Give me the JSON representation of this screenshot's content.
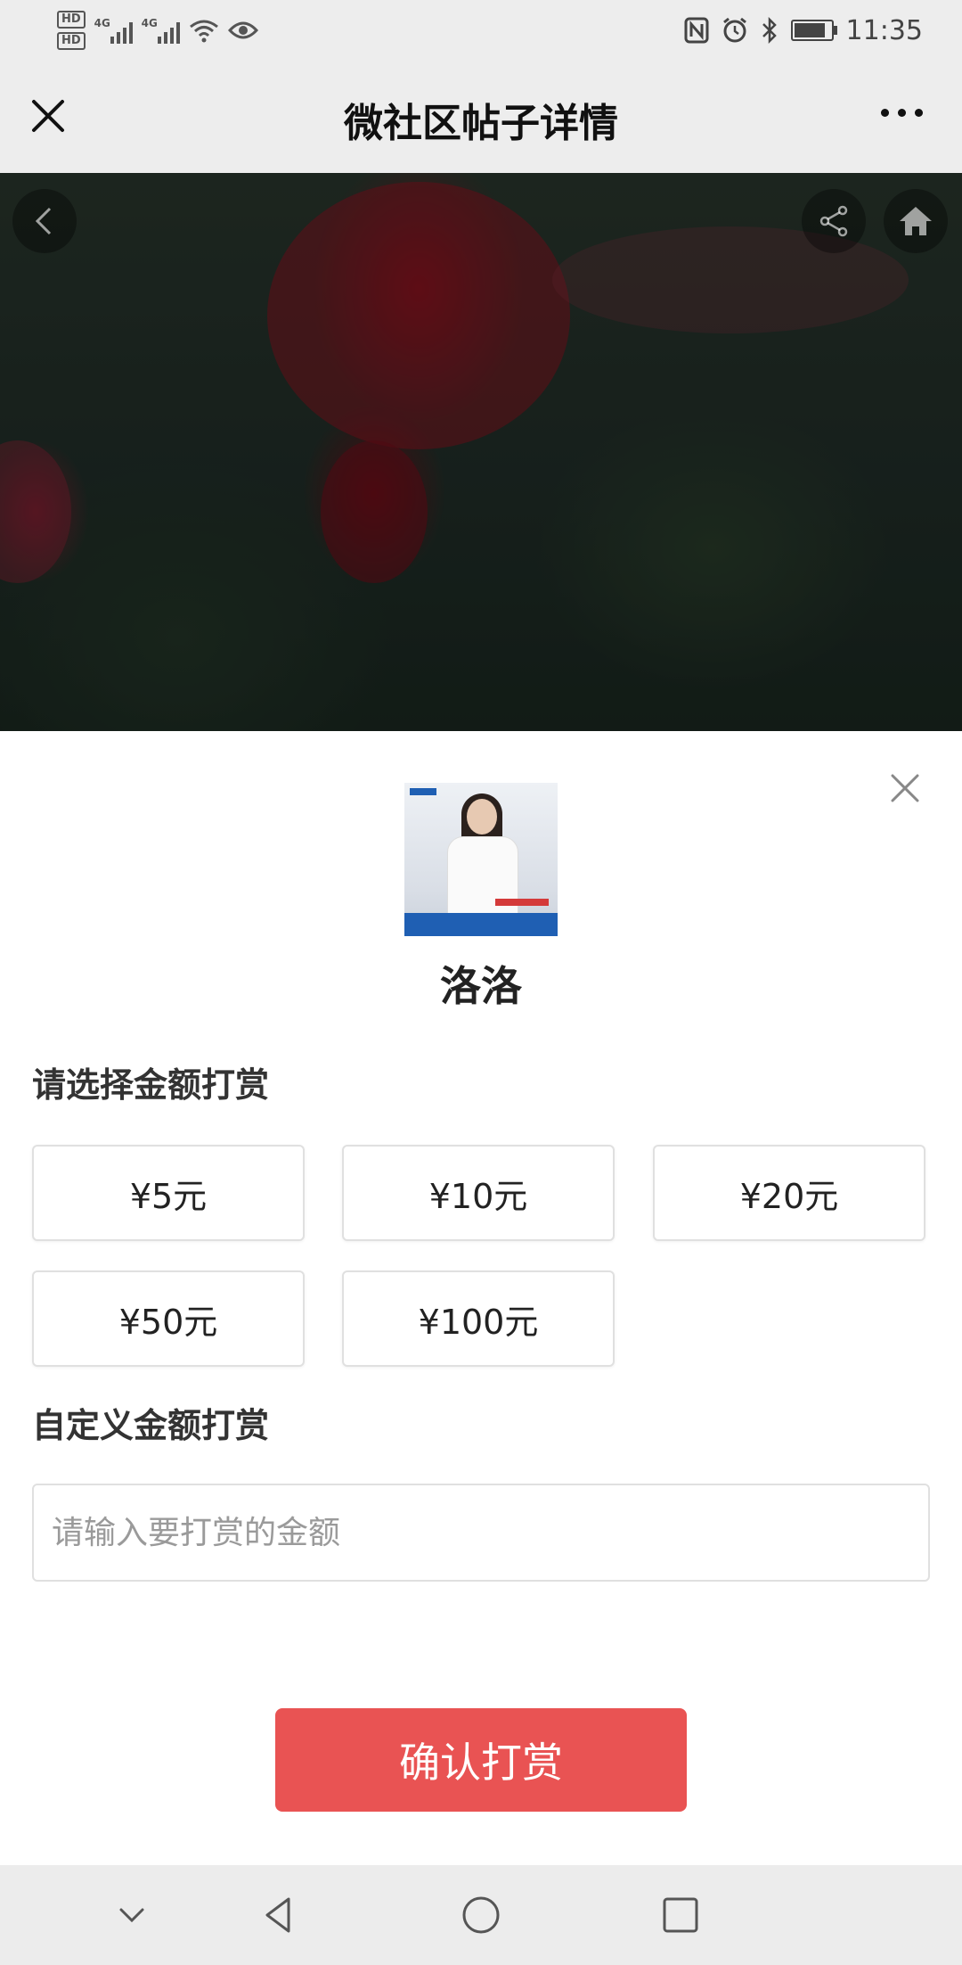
{
  "status_bar": {
    "hd1": "HD",
    "hd2": "HD",
    "net1": "4G",
    "net2": "4G",
    "time": "11:35",
    "battery_level": 0.85
  },
  "title_bar": {
    "title": "微社区帖子详情"
  },
  "reward": {
    "author_name": "洛洛",
    "select_label": "请选择金额打赏",
    "amounts": [
      "¥5元",
      "¥10元",
      "¥20元",
      "¥50元",
      "¥100元"
    ],
    "custom_label": "自定义金额打赏",
    "custom_placeholder": "请输入要打赏的金额",
    "custom_value": "",
    "confirm_label": "确认打赏"
  },
  "colors": {
    "confirm_bg": "#e95353",
    "bar_bg": "#ededed"
  },
  "icons": {
    "close": "close-icon",
    "more": "more-icon",
    "back": "back-icon",
    "share": "share-icon",
    "home": "home-icon",
    "sheet_close": "close-icon",
    "nav": [
      "chevron-down-icon",
      "nav-back-icon",
      "nav-home-icon",
      "nav-recents-icon"
    ]
  }
}
